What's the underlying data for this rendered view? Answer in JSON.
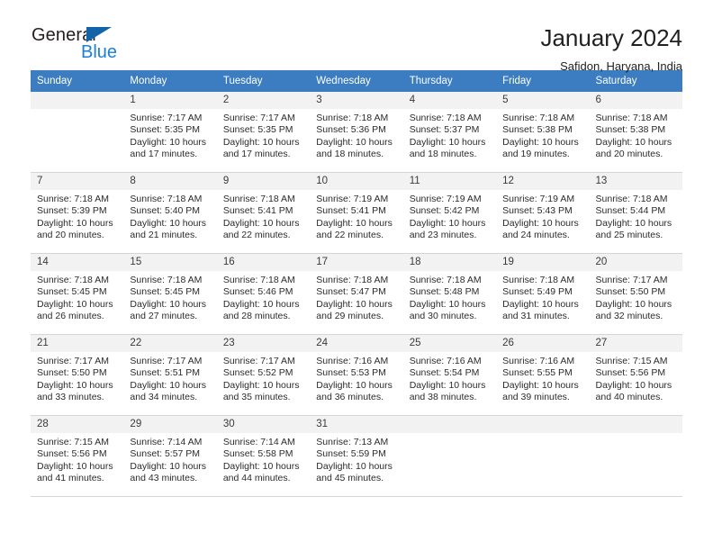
{
  "logo": {
    "primary_text": "General",
    "secondary_text": "Blue",
    "triangle_color": "#1263a8",
    "blue_color": "#1b7fd4"
  },
  "header": {
    "title": "January 2024",
    "subtitle": "Safidon, Haryana, India"
  },
  "theme": {
    "header_bar_color": "#3b7dc0",
    "daynum_bg": "#f2f2f2",
    "grid_line": "#d6d6d6"
  },
  "weekdays": [
    "Sunday",
    "Monday",
    "Tuesday",
    "Wednesday",
    "Thursday",
    "Friday",
    "Saturday"
  ],
  "weeks": [
    [
      {
        "day": "",
        "sunrise": "",
        "sunset": "",
        "daylight_line1": "",
        "daylight_line2": "",
        "empty": true
      },
      {
        "day": "1",
        "sunrise": "Sunrise: 7:17 AM",
        "sunset": "Sunset: 5:35 PM",
        "daylight_line1": "Daylight: 10 hours",
        "daylight_line2": "and 17 minutes.",
        "empty": false
      },
      {
        "day": "2",
        "sunrise": "Sunrise: 7:17 AM",
        "sunset": "Sunset: 5:35 PM",
        "daylight_line1": "Daylight: 10 hours",
        "daylight_line2": "and 17 minutes.",
        "empty": false
      },
      {
        "day": "3",
        "sunrise": "Sunrise: 7:18 AM",
        "sunset": "Sunset: 5:36 PM",
        "daylight_line1": "Daylight: 10 hours",
        "daylight_line2": "and 18 minutes.",
        "empty": false
      },
      {
        "day": "4",
        "sunrise": "Sunrise: 7:18 AM",
        "sunset": "Sunset: 5:37 PM",
        "daylight_line1": "Daylight: 10 hours",
        "daylight_line2": "and 18 minutes.",
        "empty": false
      },
      {
        "day": "5",
        "sunrise": "Sunrise: 7:18 AM",
        "sunset": "Sunset: 5:38 PM",
        "daylight_line1": "Daylight: 10 hours",
        "daylight_line2": "and 19 minutes.",
        "empty": false
      },
      {
        "day": "6",
        "sunrise": "Sunrise: 7:18 AM",
        "sunset": "Sunset: 5:38 PM",
        "daylight_line1": "Daylight: 10 hours",
        "daylight_line2": "and 20 minutes.",
        "empty": false
      }
    ],
    [
      {
        "day": "7",
        "sunrise": "Sunrise: 7:18 AM",
        "sunset": "Sunset: 5:39 PM",
        "daylight_line1": "Daylight: 10 hours",
        "daylight_line2": "and 20 minutes.",
        "empty": false
      },
      {
        "day": "8",
        "sunrise": "Sunrise: 7:18 AM",
        "sunset": "Sunset: 5:40 PM",
        "daylight_line1": "Daylight: 10 hours",
        "daylight_line2": "and 21 minutes.",
        "empty": false
      },
      {
        "day": "9",
        "sunrise": "Sunrise: 7:18 AM",
        "sunset": "Sunset: 5:41 PM",
        "daylight_line1": "Daylight: 10 hours",
        "daylight_line2": "and 22 minutes.",
        "empty": false
      },
      {
        "day": "10",
        "sunrise": "Sunrise: 7:19 AM",
        "sunset": "Sunset: 5:41 PM",
        "daylight_line1": "Daylight: 10 hours",
        "daylight_line2": "and 22 minutes.",
        "empty": false
      },
      {
        "day": "11",
        "sunrise": "Sunrise: 7:19 AM",
        "sunset": "Sunset: 5:42 PM",
        "daylight_line1": "Daylight: 10 hours",
        "daylight_line2": "and 23 minutes.",
        "empty": false
      },
      {
        "day": "12",
        "sunrise": "Sunrise: 7:19 AM",
        "sunset": "Sunset: 5:43 PM",
        "daylight_line1": "Daylight: 10 hours",
        "daylight_line2": "and 24 minutes.",
        "empty": false
      },
      {
        "day": "13",
        "sunrise": "Sunrise: 7:18 AM",
        "sunset": "Sunset: 5:44 PM",
        "daylight_line1": "Daylight: 10 hours",
        "daylight_line2": "and 25 minutes.",
        "empty": false
      }
    ],
    [
      {
        "day": "14",
        "sunrise": "Sunrise: 7:18 AM",
        "sunset": "Sunset: 5:45 PM",
        "daylight_line1": "Daylight: 10 hours",
        "daylight_line2": "and 26 minutes.",
        "empty": false
      },
      {
        "day": "15",
        "sunrise": "Sunrise: 7:18 AM",
        "sunset": "Sunset: 5:45 PM",
        "daylight_line1": "Daylight: 10 hours",
        "daylight_line2": "and 27 minutes.",
        "empty": false
      },
      {
        "day": "16",
        "sunrise": "Sunrise: 7:18 AM",
        "sunset": "Sunset: 5:46 PM",
        "daylight_line1": "Daylight: 10 hours",
        "daylight_line2": "and 28 minutes.",
        "empty": false
      },
      {
        "day": "17",
        "sunrise": "Sunrise: 7:18 AM",
        "sunset": "Sunset: 5:47 PM",
        "daylight_line1": "Daylight: 10 hours",
        "daylight_line2": "and 29 minutes.",
        "empty": false
      },
      {
        "day": "18",
        "sunrise": "Sunrise: 7:18 AM",
        "sunset": "Sunset: 5:48 PM",
        "daylight_line1": "Daylight: 10 hours",
        "daylight_line2": "and 30 minutes.",
        "empty": false
      },
      {
        "day": "19",
        "sunrise": "Sunrise: 7:18 AM",
        "sunset": "Sunset: 5:49 PM",
        "daylight_line1": "Daylight: 10 hours",
        "daylight_line2": "and 31 minutes.",
        "empty": false
      },
      {
        "day": "20",
        "sunrise": "Sunrise: 7:17 AM",
        "sunset": "Sunset: 5:50 PM",
        "daylight_line1": "Daylight: 10 hours",
        "daylight_line2": "and 32 minutes.",
        "empty": false
      }
    ],
    [
      {
        "day": "21",
        "sunrise": "Sunrise: 7:17 AM",
        "sunset": "Sunset: 5:50 PM",
        "daylight_line1": "Daylight: 10 hours",
        "daylight_line2": "and 33 minutes.",
        "empty": false
      },
      {
        "day": "22",
        "sunrise": "Sunrise: 7:17 AM",
        "sunset": "Sunset: 5:51 PM",
        "daylight_line1": "Daylight: 10 hours",
        "daylight_line2": "and 34 minutes.",
        "empty": false
      },
      {
        "day": "23",
        "sunrise": "Sunrise: 7:17 AM",
        "sunset": "Sunset: 5:52 PM",
        "daylight_line1": "Daylight: 10 hours",
        "daylight_line2": "and 35 minutes.",
        "empty": false
      },
      {
        "day": "24",
        "sunrise": "Sunrise: 7:16 AM",
        "sunset": "Sunset: 5:53 PM",
        "daylight_line1": "Daylight: 10 hours",
        "daylight_line2": "and 36 minutes.",
        "empty": false
      },
      {
        "day": "25",
        "sunrise": "Sunrise: 7:16 AM",
        "sunset": "Sunset: 5:54 PM",
        "daylight_line1": "Daylight: 10 hours",
        "daylight_line2": "and 38 minutes.",
        "empty": false
      },
      {
        "day": "26",
        "sunrise": "Sunrise: 7:16 AM",
        "sunset": "Sunset: 5:55 PM",
        "daylight_line1": "Daylight: 10 hours",
        "daylight_line2": "and 39 minutes.",
        "empty": false
      },
      {
        "day": "27",
        "sunrise": "Sunrise: 7:15 AM",
        "sunset": "Sunset: 5:56 PM",
        "daylight_line1": "Daylight: 10 hours",
        "daylight_line2": "and 40 minutes.",
        "empty": false
      }
    ],
    [
      {
        "day": "28",
        "sunrise": "Sunrise: 7:15 AM",
        "sunset": "Sunset: 5:56 PM",
        "daylight_line1": "Daylight: 10 hours",
        "daylight_line2": "and 41 minutes.",
        "empty": false
      },
      {
        "day": "29",
        "sunrise": "Sunrise: 7:14 AM",
        "sunset": "Sunset: 5:57 PM",
        "daylight_line1": "Daylight: 10 hours",
        "daylight_line2": "and 43 minutes.",
        "empty": false
      },
      {
        "day": "30",
        "sunrise": "Sunrise: 7:14 AM",
        "sunset": "Sunset: 5:58 PM",
        "daylight_line1": "Daylight: 10 hours",
        "daylight_line2": "and 44 minutes.",
        "empty": false
      },
      {
        "day": "31",
        "sunrise": "Sunrise: 7:13 AM",
        "sunset": "Sunset: 5:59 PM",
        "daylight_line1": "Daylight: 10 hours",
        "daylight_line2": "and 45 minutes.",
        "empty": false
      },
      {
        "day": "",
        "sunrise": "",
        "sunset": "",
        "daylight_line1": "",
        "daylight_line2": "",
        "empty": true
      },
      {
        "day": "",
        "sunrise": "",
        "sunset": "",
        "daylight_line1": "",
        "daylight_line2": "",
        "empty": true
      },
      {
        "day": "",
        "sunrise": "",
        "sunset": "",
        "daylight_line1": "",
        "daylight_line2": "",
        "empty": true
      }
    ]
  ]
}
